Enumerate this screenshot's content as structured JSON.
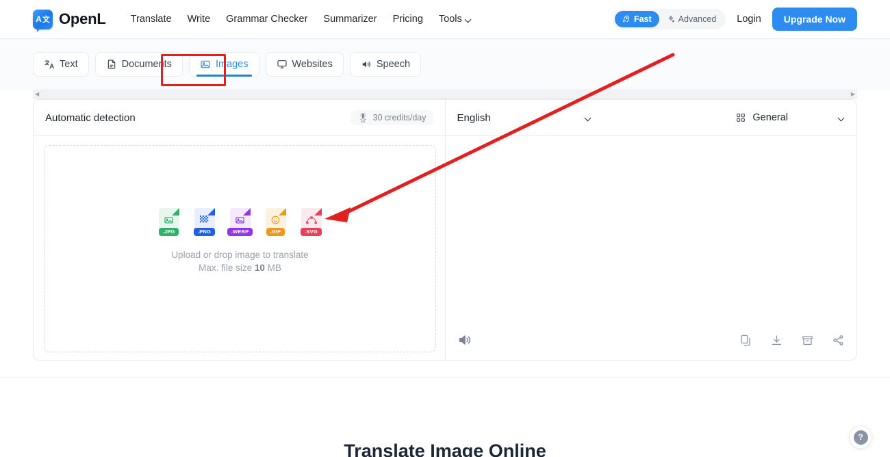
{
  "header": {
    "brand_name": "OpenL",
    "logo_letter_a": "A",
    "logo_letter_cjk": "文",
    "nav": [
      {
        "label": "Translate",
        "has_caret": false
      },
      {
        "label": "Write",
        "has_caret": false
      },
      {
        "label": "Grammar Checker",
        "has_caret": false
      },
      {
        "label": "Summarizer",
        "has_caret": false
      },
      {
        "label": "Pricing",
        "has_caret": false
      },
      {
        "label": "Tools",
        "has_caret": true
      }
    ],
    "mode_fast": "Fast",
    "mode_advanced": "Advanced",
    "login": "Login",
    "upgrade": "Upgrade Now"
  },
  "tabs": [
    {
      "label": "Text",
      "icon": "translate-icon",
      "active": false
    },
    {
      "label": "Documents",
      "icon": "document-icon",
      "active": false
    },
    {
      "label": "Images",
      "icon": "image-icon",
      "active": true
    },
    {
      "label": "Websites",
      "icon": "monitor-icon",
      "active": false
    },
    {
      "label": "Speech",
      "icon": "speaker-icon",
      "active": false
    }
  ],
  "source_panel": {
    "language": "Automatic detection",
    "credits": "30 credits/day",
    "credits_icon": "medal-icon",
    "dropzone": {
      "upload_line": "Upload or drop image to translate",
      "maxsize_prefix": "Max. file size ",
      "maxsize_value": "10",
      "maxsize_suffix": " MB",
      "filetypes": [
        {
          "label": ".JPG",
          "color": "#2bb36a",
          "bg": "#e7f7ee",
          "glyph": "image"
        },
        {
          "label": ".PNG",
          "color": "#1e62e0",
          "bg": "#e8eefc",
          "glyph": "checker"
        },
        {
          "label": ".WEBP",
          "color": "#9333ea",
          "bg": "#f4e9fd",
          "glyph": "image"
        },
        {
          "label": ".GIF",
          "color": "#f0971b",
          "bg": "#fdf2e0",
          "glyph": "smiley"
        },
        {
          "label": ".SVG",
          "color": "#e8405a",
          "bg": "#fdeaee",
          "glyph": "curve"
        }
      ]
    }
  },
  "target_panel": {
    "language": "English",
    "category": "General",
    "category_icon": "grid-icon",
    "speaker_icon": "speaker-icon",
    "actions": [
      {
        "name": "copy-icon",
        "title": "Copy"
      },
      {
        "name": "download-icon",
        "title": "Download"
      },
      {
        "name": "archive-icon",
        "title": "Archive"
      },
      {
        "name": "share-icon",
        "title": "Share"
      }
    ]
  },
  "lower": {
    "heading": "Translate Image Online",
    "help": "?"
  },
  "colors": {
    "accent": "#2d8cf0",
    "annotation": "#e41f1f",
    "tab_active_underline": "#1f7fd6"
  }
}
